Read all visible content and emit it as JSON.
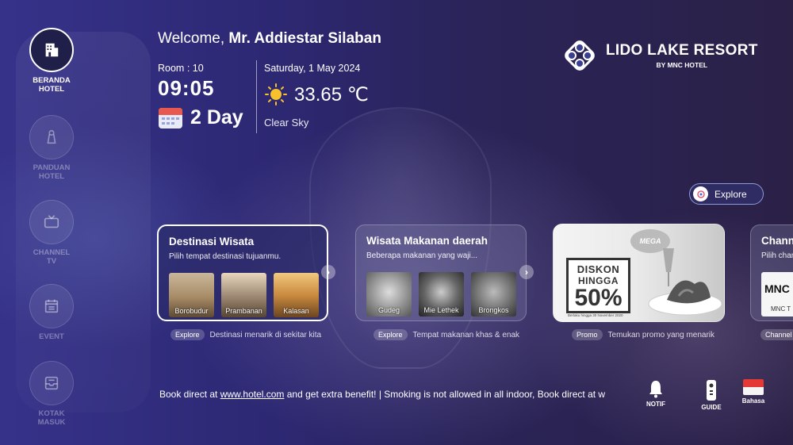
{
  "sidebar": {
    "items": [
      {
        "label_1": "BERANDA",
        "label_2": "HOTEL",
        "icon": "hotel-icon",
        "active": true
      },
      {
        "label_1": "PANDUAN",
        "label_2": "HOTEL",
        "icon": "door-hanger-icon"
      },
      {
        "label_1": "CHANNEL",
        "label_2": "TV",
        "icon": "tv-icon"
      },
      {
        "label_1": "EVENT",
        "label_2": "",
        "icon": "calendar-icon"
      },
      {
        "label_1": "KOTAK",
        "label_2": "MASUK",
        "icon": "inbox-icon"
      }
    ]
  },
  "header": {
    "welcome_prefix": "Welcome,",
    "guest_name": "Mr. Addiestar Silaban",
    "room": "Room : 10",
    "time": "09:05",
    "stay": "2 Day",
    "date": "Saturday, 1 May 2024",
    "temperature": "33.65 ℃",
    "sky": "Clear Sky"
  },
  "logo": {
    "name": "LIDO LAKE RESORT",
    "sub": "BY MNC HOTEL"
  },
  "explore_button": {
    "label": "Explore"
  },
  "cards": [
    {
      "title": "Destinasi Wisata",
      "subtitle": "Pilih tempat destinasi tujuanmu.",
      "thumbs": [
        "Borobudur",
        "Prambanan",
        "Kalasan"
      ],
      "tag": "Explore",
      "caption": "Destinasi menarik di sekitar kita"
    },
    {
      "title": "Wisata Makanan daerah",
      "subtitle": "Beberapa makanan yang waji...",
      "thumbs": [
        "Gudeg",
        "Mie Lethek",
        "Brongkos"
      ],
      "tag": "Explore",
      "caption": "Tempat makanan khas & enak"
    },
    {
      "tag": "Promo",
      "caption": "Temukan promo yang menarik",
      "promo": {
        "line1": "DISKON",
        "line2": "HINGGA",
        "line3": "50%",
        "badge": "MEGA",
        "footnote": "Berlaku hingga 30 November 2020"
      }
    },
    {
      "title": "Chann",
      "subtitle": "Pilih chan",
      "thumb_logo": "MNC",
      "thumb_label": "MNC T",
      "tag": "Channel"
    }
  ],
  "ticker": {
    "before": "Book direct at ",
    "link": "www.hotel.com",
    "after": " and get extra benefit! | Smoking is not allowed in all indoor, Book direct at w"
  },
  "bottom": {
    "notif": "NOTIF",
    "guide": "GUIDE",
    "bahasa": "Bahasa"
  },
  "colors": {
    "background": "#2d2872",
    "pill_border": "#8e9bd6",
    "logo_blue": "#3a3f8f",
    "flag_red": "#e53935"
  }
}
